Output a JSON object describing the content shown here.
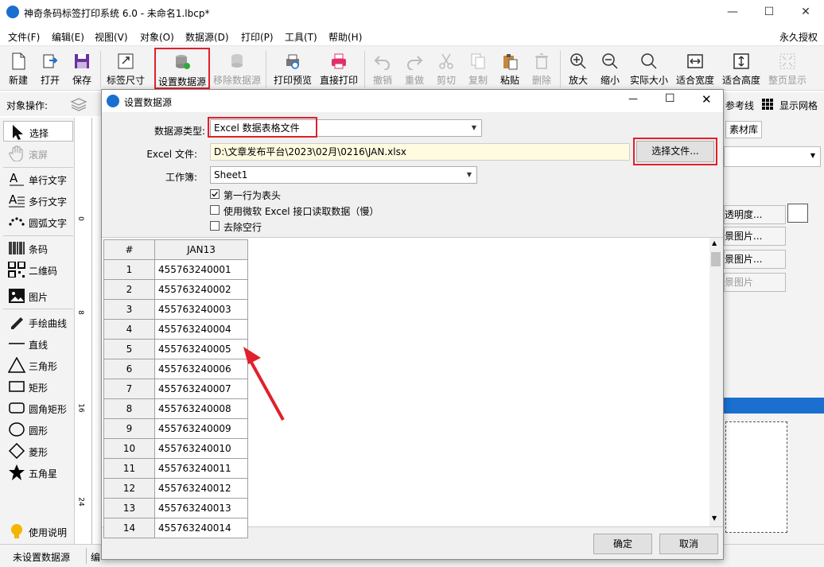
{
  "window": {
    "title": "神奇条码标签打印系统 6.0 - 未命名1.lbcp*",
    "minimize": "—",
    "maximize": "☐",
    "close": "✕"
  },
  "menu": [
    "文件(F)",
    "编辑(E)",
    "视图(V)",
    "对象(O)",
    "数据源(D)",
    "打印(P)",
    "工具(T)",
    "帮助(H)"
  ],
  "menu_right": "永久授权",
  "toolbar": [
    {
      "label": "新建",
      "icon": "new-file-icon",
      "enabled": true
    },
    {
      "label": "打开",
      "icon": "open-icon",
      "enabled": true
    },
    {
      "label": "保存",
      "icon": "save-icon",
      "enabled": true
    },
    {
      "label": "标签尺寸",
      "icon": "label-size-icon",
      "enabled": true
    },
    {
      "label": "设置数据源",
      "icon": "database-icon",
      "enabled": true
    },
    {
      "label": "移除数据源",
      "icon": "database-remove-icon",
      "enabled": false
    },
    {
      "label": "打印预览",
      "icon": "print-preview-icon",
      "enabled": true
    },
    {
      "label": "直接打印",
      "icon": "printer-icon",
      "enabled": true
    },
    {
      "label": "撤销",
      "icon": "undo-icon",
      "enabled": false
    },
    {
      "label": "重做",
      "icon": "redo-icon",
      "enabled": false
    },
    {
      "label": "剪切",
      "icon": "cut-icon",
      "enabled": false
    },
    {
      "label": "复制",
      "icon": "copy-icon",
      "enabled": false
    },
    {
      "label": "粘贴",
      "icon": "paste-icon",
      "enabled": true
    },
    {
      "label": "删除",
      "icon": "delete-icon",
      "enabled": false
    },
    {
      "label": "放大",
      "icon": "zoom-in-icon",
      "enabled": true
    },
    {
      "label": "缩小",
      "icon": "zoom-out-icon",
      "enabled": true
    },
    {
      "label": "实际大小",
      "icon": "actual-size-icon",
      "enabled": true
    },
    {
      "label": "适合宽度",
      "icon": "fit-width-icon",
      "enabled": true
    },
    {
      "label": "适合高度",
      "icon": "fit-height-icon",
      "enabled": true
    },
    {
      "label": "整页显示",
      "icon": "full-page-icon",
      "enabled": false
    }
  ],
  "objbar": {
    "label": "对象操作:",
    "guides": "参考线",
    "show_grid": "显示网格"
  },
  "tools": [
    {
      "label": "选择",
      "icon": "cursor-icon"
    },
    {
      "label": "滚屏",
      "icon": "hand-icon"
    },
    {
      "label": "单行文字",
      "icon": "single-text-icon"
    },
    {
      "label": "多行文字",
      "icon": "multi-text-icon"
    },
    {
      "label": "圆弧文字",
      "icon": "arc-text-icon"
    },
    {
      "label": "条码",
      "icon": "barcode-icon"
    },
    {
      "label": "二维码",
      "icon": "qrcode-icon"
    },
    {
      "label": "图片",
      "icon": "image-icon"
    },
    {
      "label": "手绘曲线",
      "icon": "pen-icon"
    },
    {
      "label": "直线",
      "icon": "line-icon"
    },
    {
      "label": "三角形",
      "icon": "triangle-icon"
    },
    {
      "label": "矩形",
      "icon": "rectangle-icon"
    },
    {
      "label": "圆角矩形",
      "icon": "rounded-rect-icon"
    },
    {
      "label": "圆形",
      "icon": "circle-icon"
    },
    {
      "label": "菱形",
      "icon": "diamond-icon"
    },
    {
      "label": "五角星",
      "icon": "star-icon"
    }
  ],
  "help": "使用说明",
  "ruler_marks": [
    "8",
    "16",
    "24"
  ],
  "ruler_top_mark": "0",
  "right": {
    "tab": "素材库",
    "btns": [
      "透明度...",
      "景图片...",
      "景图片...",
      "景图片"
    ]
  },
  "status": {
    "left": "未设置数据源",
    "next": "编"
  },
  "dialog": {
    "title": "设置数据源",
    "type_label": "数据源类型:",
    "type_value": "Excel 数据表格文件",
    "file_label": "Excel 文件:",
    "file_value": "D:\\文章发布平台\\2023\\02月\\0216\\JAN.xlsx",
    "choose_btn": "选择文件...",
    "sheet_label": "工作簿:",
    "sheet_value": "Sheet1",
    "opt1": "第一行为表头",
    "opt2": "使用微软 Excel 接口读取数据（慢）",
    "opt3": "去除空行",
    "opt1_checked": true,
    "col_num": "#",
    "col_name": "JAN13",
    "rows": [
      [
        "1",
        "455763240001"
      ],
      [
        "2",
        "455763240002"
      ],
      [
        "3",
        "455763240003"
      ],
      [
        "4",
        "455763240004"
      ],
      [
        "5",
        "455763240005"
      ],
      [
        "6",
        "455763240006"
      ],
      [
        "7",
        "455763240007"
      ],
      [
        "8",
        "455763240008"
      ],
      [
        "9",
        "455763240009"
      ],
      [
        "10",
        "455763240010"
      ],
      [
        "11",
        "455763240011"
      ],
      [
        "12",
        "455763240012"
      ],
      [
        "13",
        "455763240013"
      ],
      [
        "14",
        "455763240014"
      ]
    ],
    "ok": "确定",
    "cancel": "取消"
  },
  "colors": {
    "accent": "#1a6fd0",
    "highlight": "#e0202a",
    "file_bg": "#fffbe0"
  }
}
